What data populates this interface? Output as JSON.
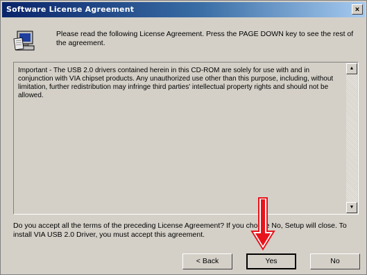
{
  "window": {
    "title": "Software License Agreement",
    "close_glyph": "×"
  },
  "header": {
    "icon": "installer-computer-icon",
    "text": "Please read the following License Agreement. Press the PAGE DOWN key to see the rest of the agreement."
  },
  "agreement": {
    "text": "Important - The USB 2.0 drivers contained herein in this CD-ROM are solely for use with and in conjunction with VIA chipset products. Any unauthorized use other than this purpose, including, without limitation, further redistribution may infringe third parties' intellectual property rights and should not be allowed.",
    "scroll_up_glyph": "▲",
    "scroll_down_glyph": "▼"
  },
  "question": {
    "text": "Do you accept all the terms of the preceding License Agreement? If you choose No, Setup will close. To install VIA USB 2.0 Driver, you must accept this agreement."
  },
  "buttons": {
    "back": "< Back",
    "yes": "Yes",
    "no": "No"
  },
  "annotation": {
    "arrow_color": "#e8141c",
    "icon": "red-arrow-down"
  }
}
